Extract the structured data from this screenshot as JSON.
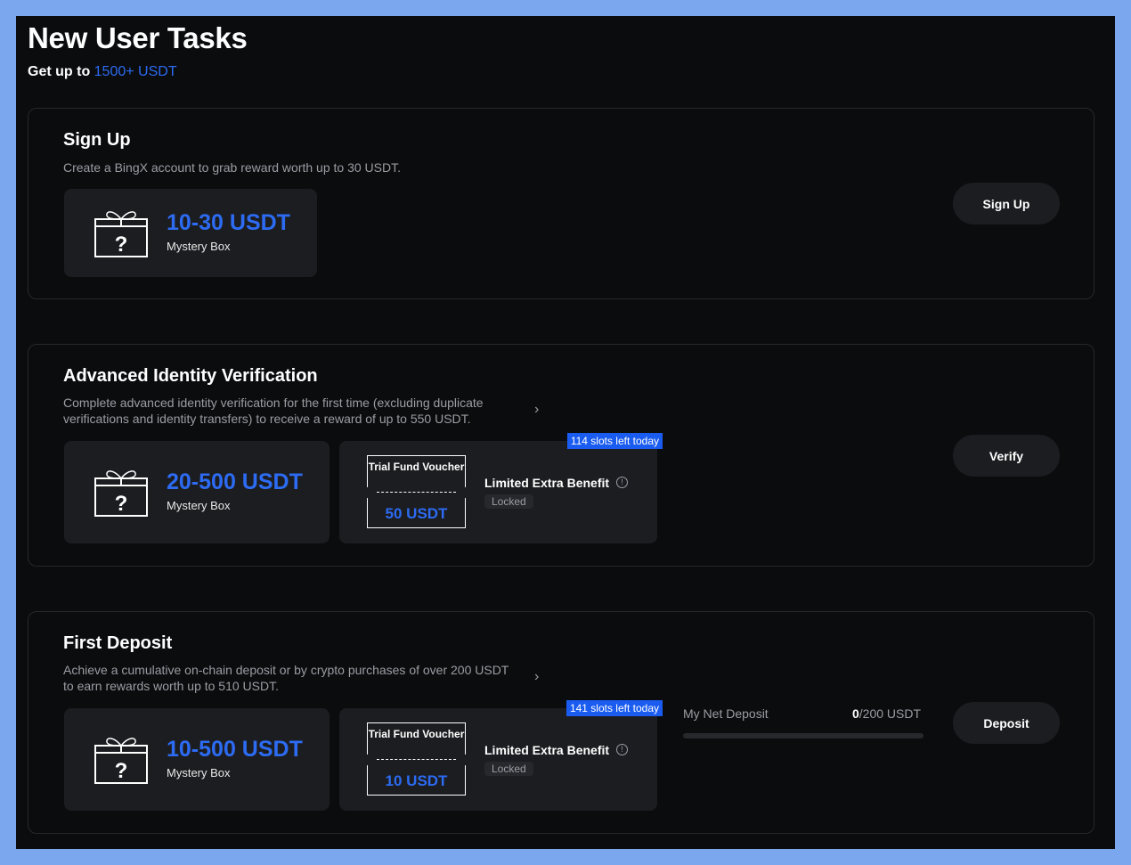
{
  "page": {
    "title": "New User Tasks",
    "subtitle_prefix": "Get up to ",
    "subtitle_highlight": "1500+ USDT"
  },
  "tasks": [
    {
      "title": "Sign Up",
      "description": "Create a BingX account to grab reward worth up to 30 USDT.",
      "reward_amount": "10-30 USDT",
      "reward_label": "Mystery Box",
      "button_label": "Sign Up"
    },
    {
      "title": "Advanced Identity Verification",
      "description": "Complete advanced identity verification for the first time (excluding duplicate verifications and identity transfers) to receive a reward of up to 550 USDT.",
      "reward_amount": "20-500 USDT",
      "reward_label": "Mystery Box",
      "voucher_title": "Trial Fund Voucher",
      "voucher_amount": "50 USDT",
      "benefit_title": "Limited Extra Benefit",
      "benefit_status": "Locked",
      "slots_badge": "114 slots left today",
      "button_label": "Verify"
    },
    {
      "title": "First Deposit",
      "description": "Achieve a cumulative on-chain deposit or by crypto purchases of over 200 USDT to earn rewards worth up to 510 USDT.",
      "reward_amount": "10-500 USDT",
      "reward_label": "Mystery Box",
      "voucher_title": "Trial Fund Voucher",
      "voucher_amount": "10 USDT",
      "benefit_title": "Limited Extra Benefit",
      "benefit_status": "Locked",
      "slots_badge": "141 slots left today",
      "net_deposit_label": "My Net Deposit",
      "net_deposit_current": "0",
      "net_deposit_target": "/200 USDT",
      "net_deposit_progress": 0,
      "button_label": "Deposit"
    }
  ],
  "icons": {
    "gift": "mystery-box-icon",
    "info": "info-icon",
    "chevron": "chevron-right-icon"
  },
  "colors": {
    "background": "#0b0c0e",
    "frame": "#7ba7ef",
    "accent": "#2c6bf2",
    "badge": "#1a5cf0",
    "surface": "#1c1d21"
  }
}
